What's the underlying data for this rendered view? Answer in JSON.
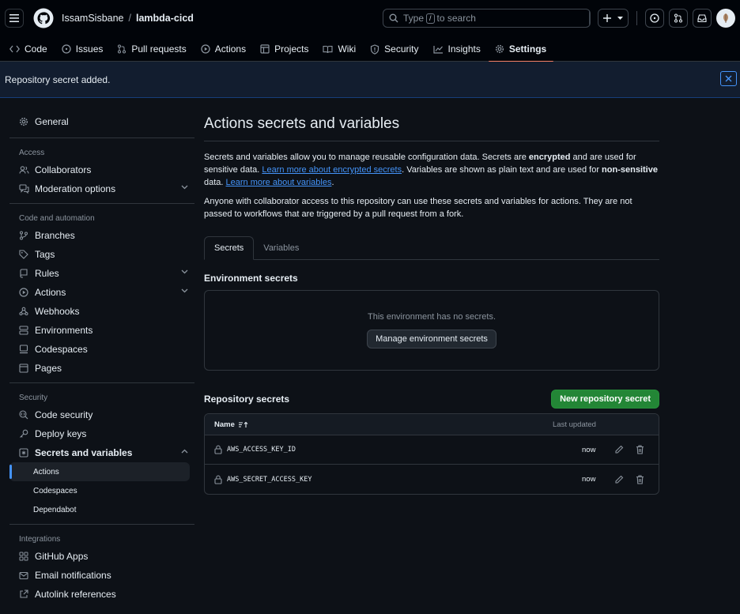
{
  "header": {
    "owner": "IssamSisbane",
    "separator": "/",
    "repo": "lambda-cicd",
    "search_prefix": "Type",
    "search_key": "/",
    "search_suffix": "to search"
  },
  "repo_nav": [
    {
      "label": "Code",
      "icon": "code-icon"
    },
    {
      "label": "Issues",
      "icon": "issue-opened-icon"
    },
    {
      "label": "Pull requests",
      "icon": "git-pull-request-icon"
    },
    {
      "label": "Actions",
      "icon": "play-icon"
    },
    {
      "label": "Projects",
      "icon": "table-icon"
    },
    {
      "label": "Wiki",
      "icon": "book-icon"
    },
    {
      "label": "Security",
      "icon": "shield-icon"
    },
    {
      "label": "Insights",
      "icon": "graph-icon"
    },
    {
      "label": "Settings",
      "icon": "gear-icon",
      "active": true
    }
  ],
  "flash": {
    "message": "Repository secret added."
  },
  "sidebar": {
    "general": "General",
    "access_heading": "Access",
    "collaborators": "Collaborators",
    "moderation": "Moderation options",
    "code_heading": "Code and automation",
    "branches": "Branches",
    "tags": "Tags",
    "rules": "Rules",
    "actions": "Actions",
    "webhooks": "Webhooks",
    "environments": "Environments",
    "codespaces": "Codespaces",
    "pages": "Pages",
    "security_heading": "Security",
    "code_security": "Code security",
    "deploy_keys": "Deploy keys",
    "secrets_vars": "Secrets and variables",
    "sub_actions": "Actions",
    "sub_codespaces": "Codespaces",
    "sub_dependabot": "Dependabot",
    "integrations_heading": "Integrations",
    "github_apps": "GitHub Apps",
    "email_notifications": "Email notifications",
    "autolink": "Autolink references"
  },
  "main": {
    "title": "Actions secrets and variables",
    "desc_1": "Secrets and variables allow you to manage reusable configuration data. Secrets are ",
    "desc_encrypted": "encrypted",
    "desc_2": " and are used for sensitive data. ",
    "desc_link1": "Learn more about encrypted secrets",
    "desc_3": ". Variables are shown as plain text and are used for ",
    "desc_nonsensitive": "non-sensitive",
    "desc_4": " data. ",
    "desc_link2": "Learn more about variables",
    "desc_5": ".",
    "desc_second": "Anyone with collaborator access to this repository can use these secrets and variables for actions. They are not passed to workflows that are triggered by a pull request from a fork.",
    "tab_secrets": "Secrets",
    "tab_variables": "Variables",
    "env_title": "Environment secrets",
    "env_empty": "This environment has no secrets.",
    "env_button": "Manage environment secrets",
    "repo_title": "Repository secrets",
    "new_button": "New repository secret",
    "col_name": "Name",
    "col_updated": "Last updated",
    "secrets": [
      {
        "name": "AWS_ACCESS_KEY_ID",
        "updated": "now"
      },
      {
        "name": "AWS_SECRET_ACCESS_KEY",
        "updated": "now"
      }
    ]
  },
  "colors": {
    "bg": "#0d1117",
    "accent_tab": "#f78166",
    "link": "#4493f8",
    "green": "#238636"
  }
}
